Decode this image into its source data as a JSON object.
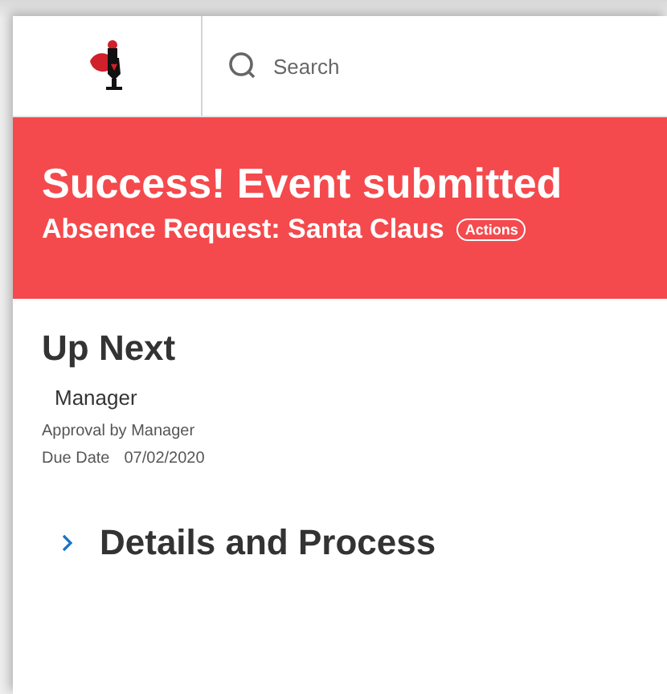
{
  "header": {
    "search": {
      "placeholder": "Search"
    }
  },
  "banner": {
    "title": "Success! Event submitted",
    "subtitle": "Absence Request: Santa Claus",
    "actions_button": "Actions"
  },
  "up_next": {
    "heading": "Up Next",
    "assignee": "Manager",
    "step": "Approval by Manager",
    "due_label": "Due Date",
    "due_value": "07/02/2020"
  },
  "details": {
    "heading": "Details and Process",
    "expanded": false
  }
}
